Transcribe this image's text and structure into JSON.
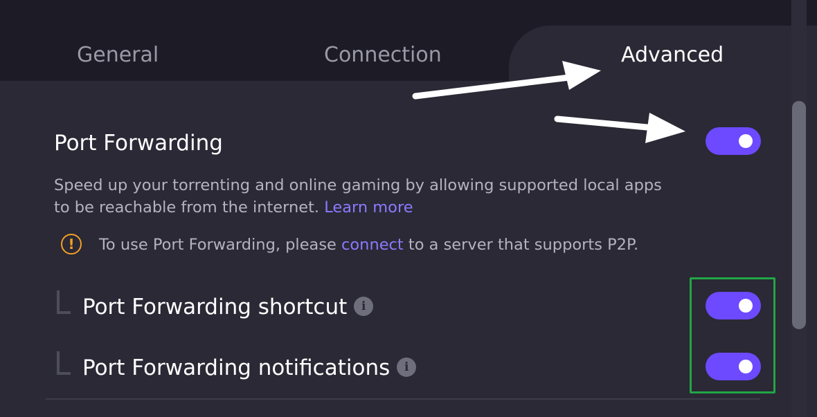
{
  "tabs": {
    "general": "General",
    "connection": "Connection",
    "advanced": "Advanced"
  },
  "port_forwarding": {
    "title": "Port Forwarding",
    "description": "Speed up your torrenting and online gaming by allowing supported local apps to be reachable from the internet.",
    "learn_more": "Learn more",
    "enabled": true,
    "warning": {
      "prefix": "To use Port Forwarding, please",
      "link": "connect",
      "suffix": "to a server that supports P2P.",
      "icon": "!"
    }
  },
  "sub_settings": [
    {
      "label": "Port Forwarding shortcut",
      "info_icon": "i",
      "enabled": true
    },
    {
      "label": "Port Forwarding notifications",
      "info_icon": "i",
      "enabled": true
    }
  ],
  "colors": {
    "accent": "#6d4aff",
    "link": "#8c79ff",
    "warning": "#f3a024",
    "highlight_box": "#22a645",
    "background": "#2a2935",
    "tab_bar": "#1d1c26"
  },
  "annotations": {
    "arrows": 2,
    "highlight_box": "green"
  }
}
